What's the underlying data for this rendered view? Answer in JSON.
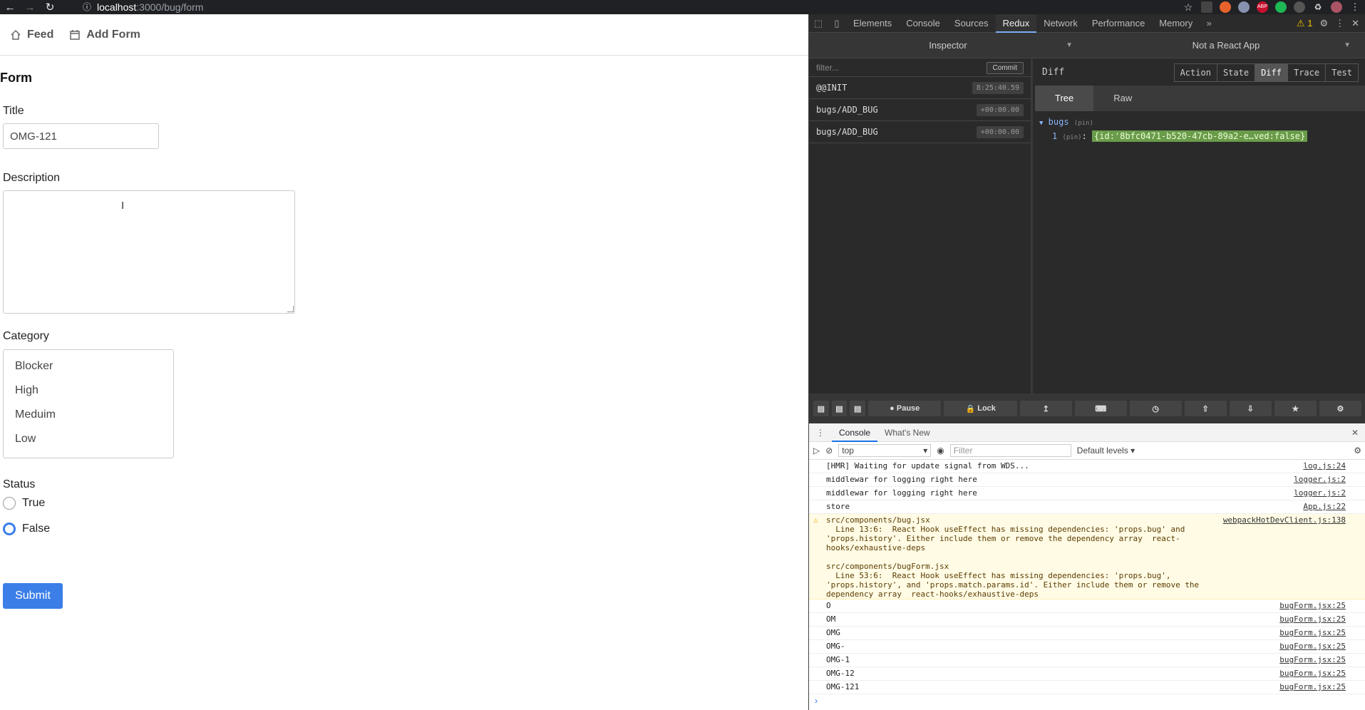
{
  "browser": {
    "url_host": "localhost",
    "url_path": ":3000/bug/form"
  },
  "app": {
    "nav": {
      "feed": "Feed",
      "add_form": "Add Form"
    },
    "page_title": "Form",
    "title_label": "Title",
    "title_value": "OMG-121",
    "description_label": "Description",
    "category_label": "Category",
    "categories": [
      "Blocker",
      "High",
      "Meduim",
      "Low"
    ],
    "status_label": "Status",
    "status_options": [
      "True",
      "False"
    ],
    "status_selected": "False",
    "submit_label": "Submit"
  },
  "devtools": {
    "tabs": [
      "Elements",
      "Console",
      "Sources",
      "Redux",
      "Network",
      "Performance",
      "Memory"
    ],
    "active_tab": "Redux",
    "warning_count": "1",
    "redux": {
      "inspector": "Inspector",
      "app_select": "Not a React App",
      "filter_placeholder": "filter...",
      "commit": "Commit",
      "actions": [
        {
          "name": "@@INIT",
          "time": "8:25:40.59"
        },
        {
          "name": "bugs/ADD_BUG",
          "time": "+00:00.00"
        },
        {
          "name": "bugs/ADD_BUG",
          "time": "+00:00.00"
        }
      ],
      "panel_title": "Diff",
      "modes": [
        "Action",
        "State",
        "Diff",
        "Trace",
        "Test"
      ],
      "active_mode": "Diff",
      "subtabs": [
        "Tree",
        "Raw"
      ],
      "tree_root": "bugs",
      "tree_pin": "(pin)",
      "tree_index": "1",
      "tree_value": "{id:'8bfc0471-b520-47cb-89a2-e…ved:false}",
      "bar": {
        "pause": "Pause",
        "lock": "Lock"
      }
    },
    "console": {
      "tabs": [
        "Console",
        "What's New"
      ],
      "context": "top",
      "filter_placeholder": "Filter",
      "levels": "Default levels",
      "lines": [
        {
          "msg": "[HMR] Waiting for update signal from WDS...",
          "src": "log.js:24"
        },
        {
          "msg": "middlewar for logging right here",
          "src": "logger.js:2"
        },
        {
          "msg": "middlewar for logging right here",
          "src": "logger.js:2"
        },
        {
          "msg": "store",
          "src": "App.js:22"
        }
      ],
      "warning": {
        "msg": "src/components/bug.jsx\n  Line 13:6:  React Hook useEffect has missing dependencies: 'props.bug' and 'props.history'. Either include them or remove the dependency array  react-hooks/exhaustive-deps\n\nsrc/components/bugForm.jsx\n  Line 53:6:  React Hook useEffect has missing dependencies: 'props.bug', 'props.history', and 'props.match.params.id'. Either include them or remove the dependency array  react-hooks/exhaustive-deps",
        "src": "webpackHotDevClient.js:138"
      },
      "logs": [
        {
          "msg": "O",
          "src": "bugForm.jsx:25"
        },
        {
          "msg": "OM",
          "src": "bugForm.jsx:25"
        },
        {
          "msg": "OMG",
          "src": "bugForm.jsx:25"
        },
        {
          "msg": "OMG-",
          "src": "bugForm.jsx:25"
        },
        {
          "msg": "OMG-1",
          "src": "bugForm.jsx:25"
        },
        {
          "msg": "OMG-12",
          "src": "bugForm.jsx:25"
        },
        {
          "msg": "OMG-121",
          "src": "bugForm.jsx:25"
        }
      ]
    }
  }
}
